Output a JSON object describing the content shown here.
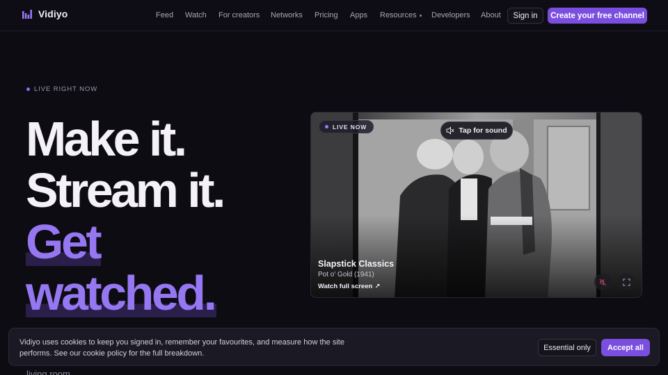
{
  "header": {
    "brand": "Vidiyo",
    "nav": [
      "Feed",
      "Watch",
      "For creators",
      "Networks",
      "Pricing",
      "Apps",
      "Resources",
      "Developers",
      "About"
    ],
    "sign_in": "Sign in",
    "cta": "Create your free channel"
  },
  "hero": {
    "eyebrow": "LIVE RIGHT NOW",
    "line1": "Make it.",
    "line2": "Stream it.",
    "accent1": "Get",
    "accent2": "watched.",
    "tail": "living room."
  },
  "player": {
    "live_badge": "LIVE NOW",
    "sound_label": "Tap for sound",
    "title": "Slapstick Classics",
    "subtitle": "Pot o' Gold (1941)",
    "watch_full": "Watch full screen",
    "watch_arrow": "↗"
  },
  "cookie": {
    "text": "Vidiyo uses cookies to keep you signed in, remember your favourites, and measure how the site performs. See our cookie policy for the full breakdown.",
    "essential": "Essential only",
    "accept": "Accept all"
  },
  "colors": {
    "accent": "#7a4fe0",
    "accent_text": "#9677f2",
    "background": "#0d0c13"
  },
  "icons": {
    "brand": "bars-logo-icon",
    "sound": "muted-speaker-icon",
    "mute": "mute-icon",
    "fullscreen": "fullscreen-icon"
  }
}
